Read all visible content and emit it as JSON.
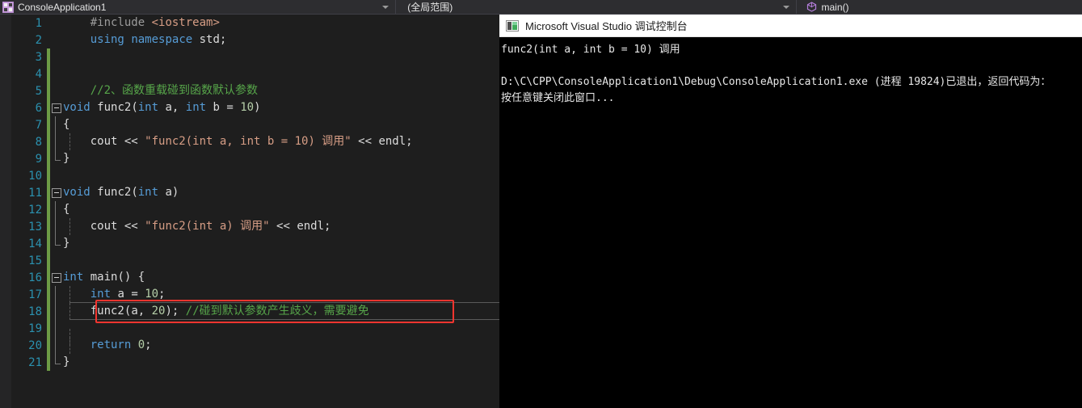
{
  "navbar": {
    "project": {
      "icon": "project-file-icon",
      "label": "ConsoleApplication1",
      "caret": "chevron-down-icon"
    },
    "scope": {
      "label": "(全局范围)",
      "caret": "chevron-down-icon"
    },
    "member": {
      "icon": "method-cube-icon",
      "label": "main()"
    }
  },
  "editor": {
    "lines": [
      {
        "n": "1",
        "changed": false,
        "fold": "",
        "indent": false,
        "text": "    #include <iostream>"
      },
      {
        "n": "2",
        "changed": false,
        "fold": "",
        "indent": false,
        "text": "    using namespace std;"
      },
      {
        "n": "3",
        "changed": true,
        "fold": "",
        "indent": false,
        "text": ""
      },
      {
        "n": "4",
        "changed": true,
        "fold": "",
        "indent": false,
        "text": ""
      },
      {
        "n": "5",
        "changed": true,
        "fold": "",
        "indent": false,
        "text": "    //2、函数重载碰到函数默认参数"
      },
      {
        "n": "6",
        "changed": true,
        "fold": "minus",
        "indent": false,
        "text": "void func2(int a, int b = 10)"
      },
      {
        "n": "7",
        "changed": true,
        "fold": "vbar",
        "indent": false,
        "text": "{"
      },
      {
        "n": "8",
        "changed": true,
        "fold": "vbar",
        "indent": true,
        "text": "    cout << \"func2(int a, int b = 10) 调用\" << endl;"
      },
      {
        "n": "9",
        "changed": true,
        "fold": "vend",
        "indent": false,
        "text": "}"
      },
      {
        "n": "10",
        "changed": true,
        "fold": "",
        "indent": false,
        "text": ""
      },
      {
        "n": "11",
        "changed": true,
        "fold": "minus",
        "indent": false,
        "text": "void func2(int a)"
      },
      {
        "n": "12",
        "changed": true,
        "fold": "vbar",
        "indent": false,
        "text": "{"
      },
      {
        "n": "13",
        "changed": true,
        "fold": "vbar",
        "indent": true,
        "text": "    cout << \"func2(int a) 调用\" << endl;"
      },
      {
        "n": "14",
        "changed": true,
        "fold": "vend",
        "indent": false,
        "text": "}"
      },
      {
        "n": "15",
        "changed": true,
        "fold": "",
        "indent": false,
        "text": ""
      },
      {
        "n": "16",
        "changed": true,
        "fold": "minus",
        "indent": false,
        "text": "int main() {"
      },
      {
        "n": "17",
        "changed": true,
        "fold": "vbar",
        "indent": true,
        "text": "    int a = 10;"
      },
      {
        "n": "18",
        "changed": true,
        "fold": "vbar",
        "indent": true,
        "text": "    func2(a, 20); //碰到默认参数产生歧义，需要避免"
      },
      {
        "n": "19",
        "changed": true,
        "fold": "vbar",
        "indent": true,
        "text": ""
      },
      {
        "n": "20",
        "changed": true,
        "fold": "vbar",
        "indent": true,
        "text": "    return 0;"
      },
      {
        "n": "21",
        "changed": true,
        "fold": "vend",
        "indent": false,
        "text": "}"
      }
    ],
    "highlight": {
      "annotation_color": "#f4352f",
      "current_line_number": "18",
      "current_line_color": "#5a5a5a",
      "change_bar_color": "#6d9b45"
    }
  },
  "console": {
    "title": "Microsoft Visual Studio 调试控制台",
    "title_icon": "console-app-icon",
    "output": [
      "func2(int a, int b = 10) 调用",
      "",
      "D:\\C\\CPP\\ConsoleApplication1\\Debug\\ConsoleApplication1.exe (进程 19824)已退出，返回代码为：",
      "按任意键关闭此窗口..."
    ]
  }
}
